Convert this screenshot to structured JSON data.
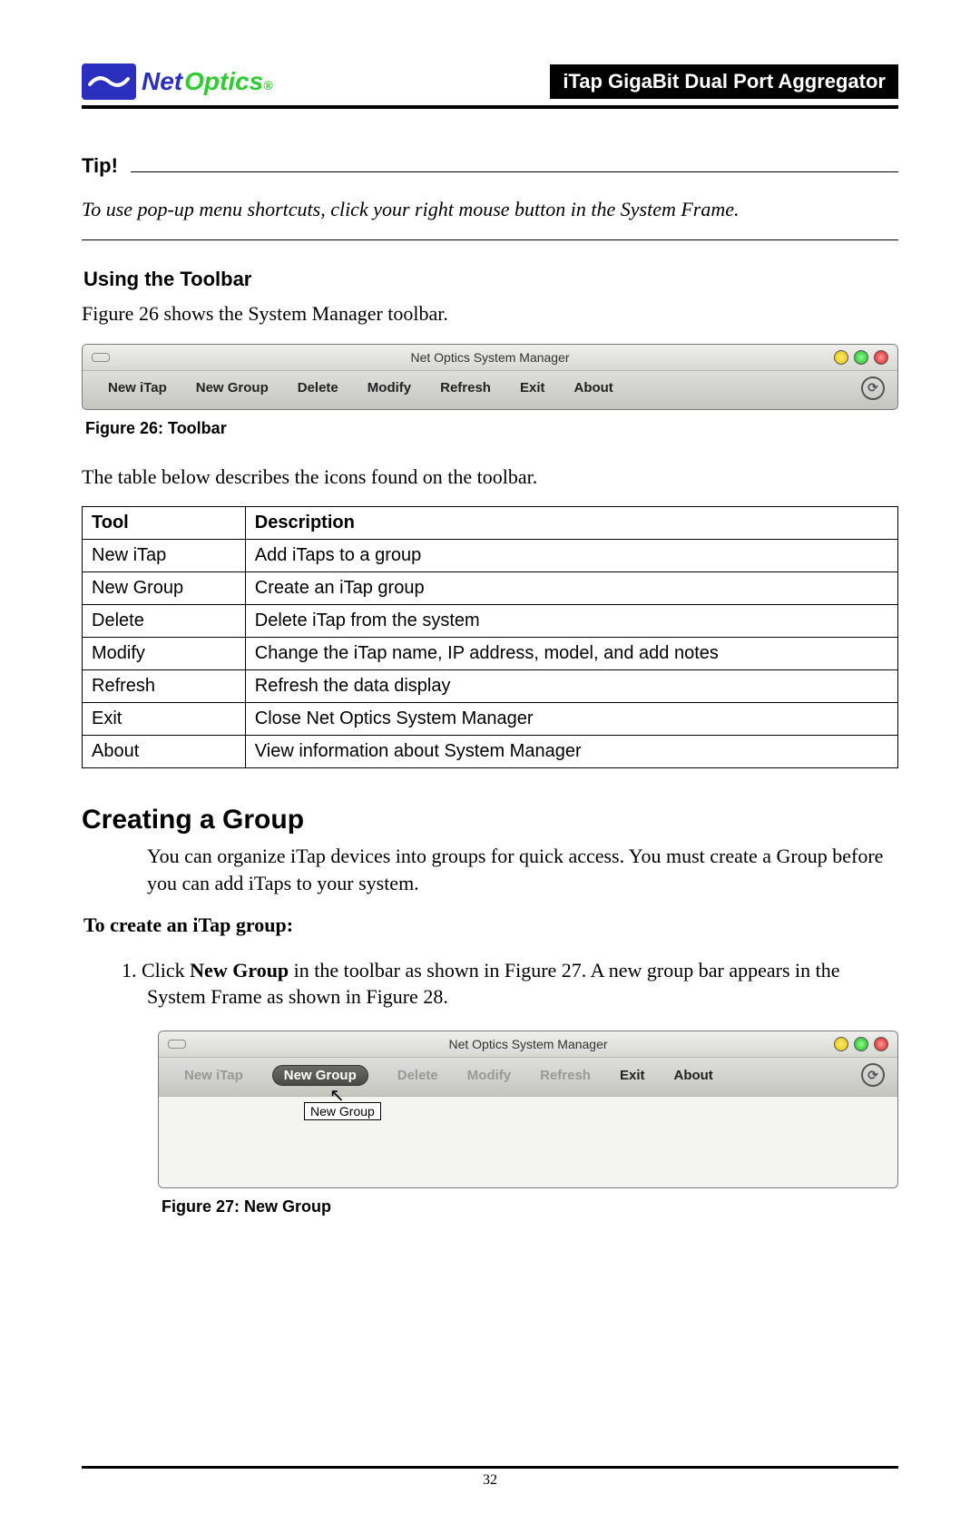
{
  "header": {
    "brand_net": "Net",
    "brand_optics": "Optics",
    "brand_reg": "®",
    "doc_title": "iTap GigaBit Dual Port Aggregator"
  },
  "tip": {
    "label": "Tip!",
    "body": "To use pop-up menu shortcuts, click your right mouse button in the System Frame."
  },
  "using_toolbar": {
    "heading": "Using the Toolbar",
    "intro": "Figure 26 shows the System Manager toolbar."
  },
  "fig26": {
    "window_title": "Net Optics System Manager",
    "items": [
      "New iTap",
      "New Group",
      "Delete",
      "Modify",
      "Refresh",
      "Exit",
      "About"
    ],
    "caption_label": "Figure 26:",
    "caption_text": " Toolbar"
  },
  "table_intro": "The table below describes the icons found on the toolbar.",
  "tool_table": {
    "headers": [
      "Tool",
      "Description"
    ],
    "rows": [
      [
        "New iTap",
        "Add iTaps to a group"
      ],
      [
        "New Group",
        "Create an iTap group"
      ],
      [
        "Delete",
        "Delete iTap from the system"
      ],
      [
        "Modify",
        "Change the iTap name, IP address, model, and add notes"
      ],
      [
        "Refresh",
        "Refresh the data display"
      ],
      [
        "Exit",
        "Close Net Optics System Manager"
      ],
      [
        "About",
        "View information about System Manager"
      ]
    ]
  },
  "creating_group": {
    "heading": "Creating a Group",
    "body": "You can organize iTap devices into groups for quick access. You must create a Group before you can add iTaps to your system.",
    "proc_heading": "To create an iTap group:",
    "step1_prefix": "1.  Click ",
    "step1_bold": "New Group",
    "step1_suffix": " in the toolbar as shown in Figure 27. A new group bar appears in the System Frame as shown in Figure 28."
  },
  "fig27": {
    "window_title": "Net Optics System Manager",
    "items": {
      "new_itap": "New iTap",
      "new_group": "New Group",
      "delete": "Delete",
      "modify": "Modify",
      "refresh": "Refresh",
      "exit": "Exit",
      "about": "About"
    },
    "tooltip": "New Group",
    "caption_label": "Figure 27:",
    "caption_text": " New Group"
  },
  "page_number": "32"
}
